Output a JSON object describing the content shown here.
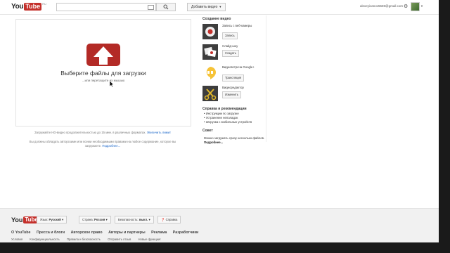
{
  "header": {
    "logo_you": "You",
    "logo_tube": "Tube",
    "logo_region": "RU",
    "upload_button": "Добавить видео",
    "email": "alexeyivanov5559@gmail.com"
  },
  "upload": {
    "title": "Выберите файлы для загрузки",
    "subtitle": "...или перетащите их мышью",
    "hd_note": "Загружайте HD-видео продолжительностью до 15 мин. в различных форматах.",
    "hd_link": "Увеличить лимит",
    "legal_text": "Вы должны обладать авторскими или всеми необходимыми правами на любое содержание, которое вы загружаете.",
    "legal_link": "Подробнее..."
  },
  "create": {
    "heading": "Создание видео",
    "tools": [
      {
        "label": "Запись с веб-камеры",
        "button": "Запись",
        "icon": "webcam-record-icon"
      },
      {
        "label": "Слайд-шоу",
        "button": "Создать",
        "icon": "slideshow-icon"
      },
      {
        "label": "Видеовстреча Google+",
        "button": "Трансляция",
        "icon": "google-hangouts-icon"
      },
      {
        "label": "Видеоредактор",
        "button": "Изменить",
        "icon": "video-editor-scissors-icon"
      }
    ]
  },
  "help": {
    "heading": "Справка и рекомендации",
    "items": [
      "Инструкции по загрузке",
      "Устранение неполадок",
      "Загрузка с мобильных устройств"
    ]
  },
  "tip": {
    "heading": "Совет",
    "text": "Можно загружать сразу несколько файлов.",
    "more": "Подробнее..."
  },
  "footer": {
    "lang_label": "Язык:",
    "lang_value": "Русский",
    "country_label": "Страна:",
    "country_value": "Россия",
    "safety_label": "Безопасность:",
    "safety_value": "выкл.",
    "help_button": "Справка",
    "links_main": [
      "О YouTube",
      "Пресса и блоги",
      "Авторское право",
      "Авторы и партнеры",
      "Реклама",
      "Разработчики"
    ],
    "links_secondary": [
      "Условия",
      "Конфиденциальность",
      "Правила и безопасность",
      "Отправить отзыв",
      "Новые функции!"
    ]
  },
  "colors": {
    "brand_red": "#c4302b",
    "upload_red": "#b32a26",
    "link_blue": "#1a66c8"
  }
}
